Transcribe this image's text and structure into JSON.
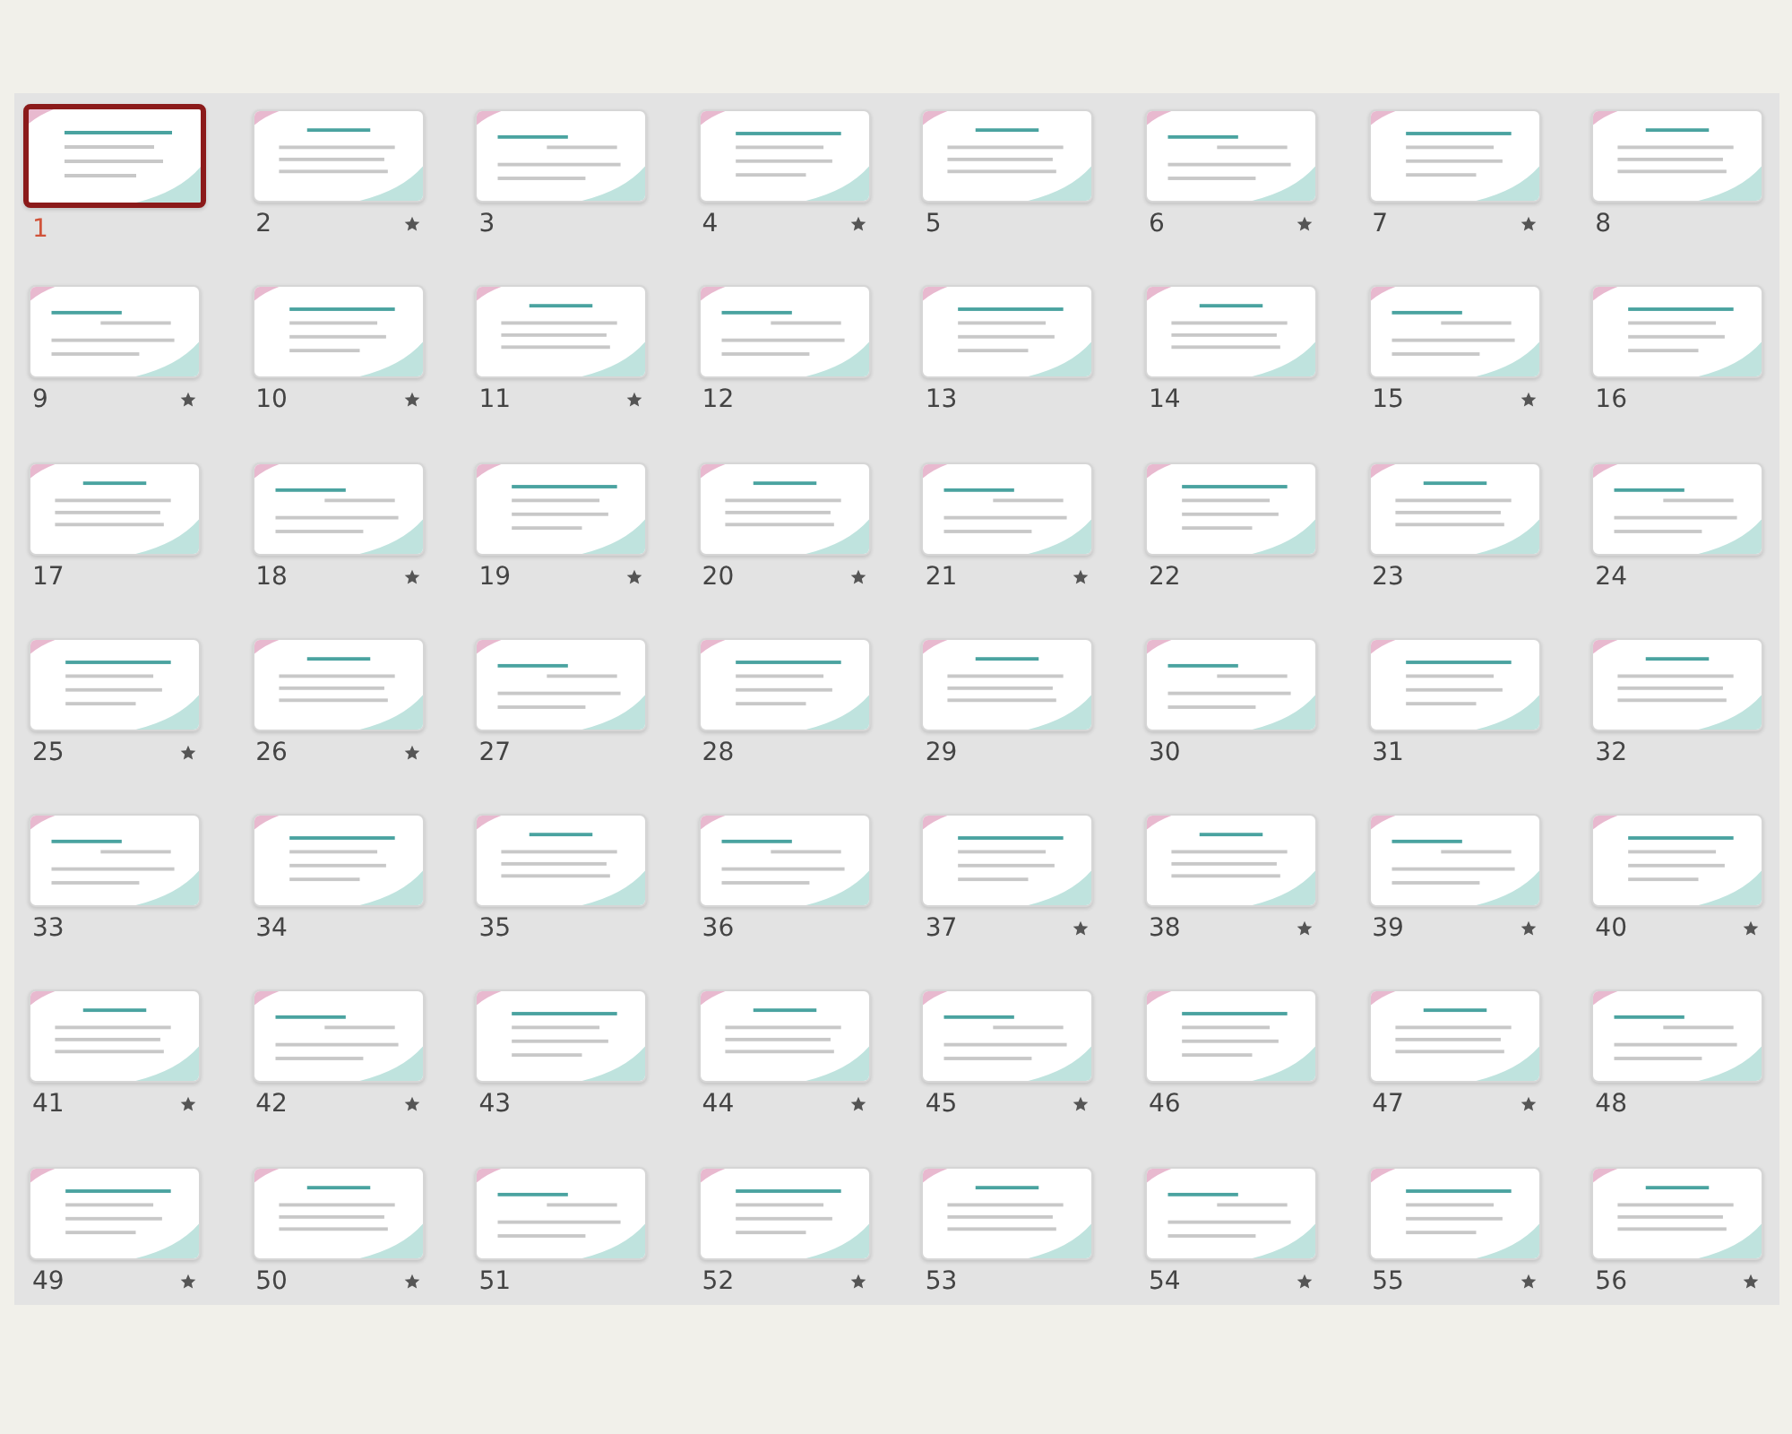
{
  "slides": [
    {
      "number": "1",
      "selected": true,
      "animated": false
    },
    {
      "number": "2",
      "selected": false,
      "animated": true
    },
    {
      "number": "3",
      "selected": false,
      "animated": false
    },
    {
      "number": "4",
      "selected": false,
      "animated": true
    },
    {
      "number": "5",
      "selected": false,
      "animated": false
    },
    {
      "number": "6",
      "selected": false,
      "animated": true
    },
    {
      "number": "7",
      "selected": false,
      "animated": true
    },
    {
      "number": "8",
      "selected": false,
      "animated": false
    },
    {
      "number": "9",
      "selected": false,
      "animated": true
    },
    {
      "number": "10",
      "selected": false,
      "animated": true
    },
    {
      "number": "11",
      "selected": false,
      "animated": true
    },
    {
      "number": "12",
      "selected": false,
      "animated": false
    },
    {
      "number": "13",
      "selected": false,
      "animated": false
    },
    {
      "number": "14",
      "selected": false,
      "animated": false
    },
    {
      "number": "15",
      "selected": false,
      "animated": true
    },
    {
      "number": "16",
      "selected": false,
      "animated": false
    },
    {
      "number": "17",
      "selected": false,
      "animated": false
    },
    {
      "number": "18",
      "selected": false,
      "animated": true
    },
    {
      "number": "19",
      "selected": false,
      "animated": true
    },
    {
      "number": "20",
      "selected": false,
      "animated": true
    },
    {
      "number": "21",
      "selected": false,
      "animated": true
    },
    {
      "number": "22",
      "selected": false,
      "animated": false
    },
    {
      "number": "23",
      "selected": false,
      "animated": false
    },
    {
      "number": "24",
      "selected": false,
      "animated": false
    },
    {
      "number": "25",
      "selected": false,
      "animated": true
    },
    {
      "number": "26",
      "selected": false,
      "animated": true
    },
    {
      "number": "27",
      "selected": false,
      "animated": false
    },
    {
      "number": "28",
      "selected": false,
      "animated": false
    },
    {
      "number": "29",
      "selected": false,
      "animated": false
    },
    {
      "number": "30",
      "selected": false,
      "animated": false
    },
    {
      "number": "31",
      "selected": false,
      "animated": false
    },
    {
      "number": "32",
      "selected": false,
      "animated": false
    },
    {
      "number": "33",
      "selected": false,
      "animated": false
    },
    {
      "number": "34",
      "selected": false,
      "animated": false
    },
    {
      "number": "35",
      "selected": false,
      "animated": false
    },
    {
      "number": "36",
      "selected": false,
      "animated": false
    },
    {
      "number": "37",
      "selected": false,
      "animated": true
    },
    {
      "number": "38",
      "selected": false,
      "animated": true
    },
    {
      "number": "39",
      "selected": false,
      "animated": true
    },
    {
      "number": "40",
      "selected": false,
      "animated": true
    },
    {
      "number": "41",
      "selected": false,
      "animated": true
    },
    {
      "number": "42",
      "selected": false,
      "animated": true
    },
    {
      "number": "43",
      "selected": false,
      "animated": false
    },
    {
      "number": "44",
      "selected": false,
      "animated": true
    },
    {
      "number": "45",
      "selected": false,
      "animated": true
    },
    {
      "number": "46",
      "selected": false,
      "animated": false
    },
    {
      "number": "47",
      "selected": false,
      "animated": true
    },
    {
      "number": "48",
      "selected": false,
      "animated": false
    },
    {
      "number": "49",
      "selected": false,
      "animated": true
    },
    {
      "number": "50",
      "selected": false,
      "animated": true
    },
    {
      "number": "51",
      "selected": false,
      "animated": false
    },
    {
      "number": "52",
      "selected": false,
      "animated": true
    },
    {
      "number": "53",
      "selected": false,
      "animated": false
    },
    {
      "number": "54",
      "selected": false,
      "animated": true
    },
    {
      "number": "55",
      "selected": false,
      "animated": true
    },
    {
      "number": "56",
      "selected": false,
      "animated": true
    }
  ]
}
